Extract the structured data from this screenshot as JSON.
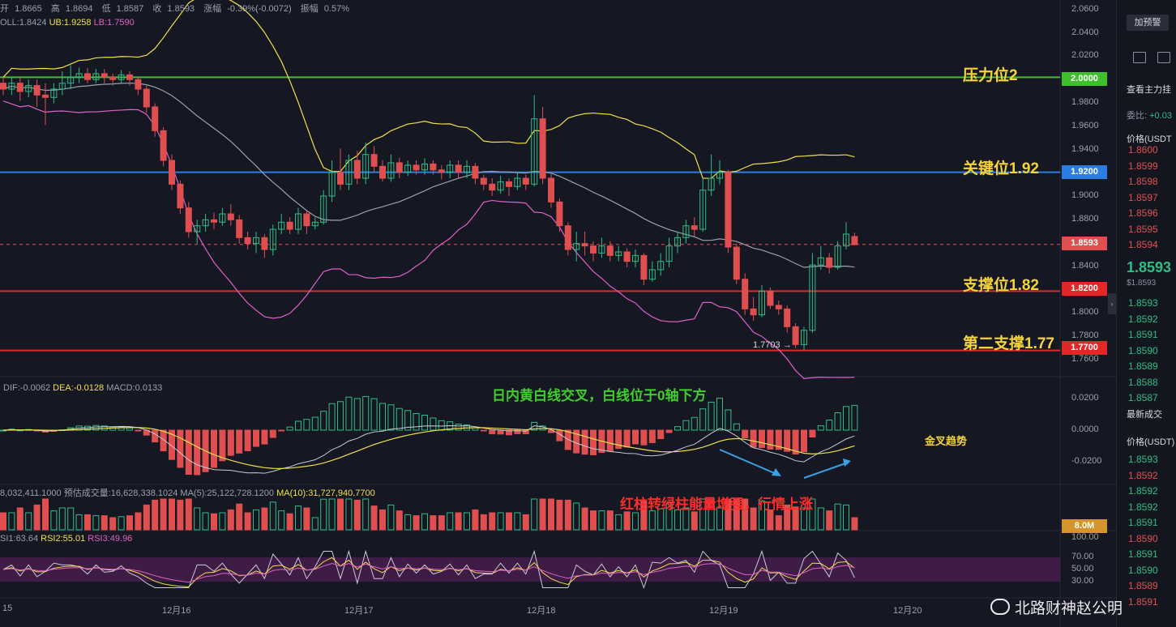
{
  "header": {
    "ohlc": [
      {
        "label": "开",
        "value": "1.8665"
      },
      {
        "label": "高",
        "value": "1.8694"
      },
      {
        "label": "低",
        "value": "1.8587"
      },
      {
        "label": "收",
        "value": "1.8593"
      },
      {
        "label": "涨幅",
        "value": "-0.39%(-0.0072)"
      },
      {
        "label": "振幅",
        "value": "0.57%"
      }
    ],
    "boll": {
      "mid": "OLL:1.8424",
      "ub": "UB:1.9258",
      "lb": "LB:1.7590"
    },
    "macd": {
      "dif": "DIF:-0.0062",
      "dea": "DEA:-0.0128",
      "macd": "MACD:0.0133"
    },
    "vol": {
      "vol": "8,032,411.1000",
      "est": "预估成交量:16,628,338.1024",
      "ma5": "MA(5):25,122,728.1200",
      "ma10": "MA(10):31,727,940.7700"
    },
    "rsi": {
      "rsi1": "SI1:63.64",
      "rsi2": "RSI2:55.01",
      "rsi3": "RSI3:49.96"
    }
  },
  "levels": [
    {
      "label": "压力位2",
      "price": "2.0000",
      "value": 2.0,
      "color": "#3fbf2c"
    },
    {
      "label": "关键位1.92",
      "price": "1.9200",
      "value": 1.92,
      "color": "#2a7de1"
    },
    {
      "label": "支撑位1.82",
      "price": "1.8200",
      "value": 1.82,
      "color": "#e02828"
    },
    {
      "label": "第二支撑1.77",
      "price": "1.7700",
      "value": 1.77,
      "color": "#e02828"
    }
  ],
  "current_price": {
    "price": "1.8593",
    "value": 1.8593
  },
  "low_marker": "1.7703",
  "annotations": {
    "macd_note": "日内黄白线交叉，白线位于0轴下方",
    "golden_cross": "金叉趋势",
    "volume_note": "红柱转绿柱能量增强，行情上涨"
  },
  "volume_tag": "8.0M",
  "watermark": "北路财神赵公明",
  "panel": {
    "alert_button": "加预警",
    "main_force": "查看主力挂",
    "ratio_label": "委比:",
    "ratio_value": "+0.03",
    "price_header": "价格(USDT",
    "ask_prices": [
      "1.8600",
      "1.8599",
      "1.8598",
      "1.8597",
      "1.8596",
      "1.8595",
      "1.8594"
    ],
    "last_price": "1.8593",
    "last_usd": "$1.8593",
    "bid_prices": [
      "1.8593",
      "1.8592",
      "1.8591",
      "1.8590",
      "1.8589",
      "1.8588",
      "1.8587"
    ],
    "trades_title": "最新成交",
    "trades_header": "价格(USDT)",
    "trades": [
      {
        "p": "1.8593",
        "c": "#2ebd85"
      },
      {
        "p": "1.8592",
        "c": "#e04f4f"
      },
      {
        "p": "1.8592",
        "c": "#2ebd85"
      },
      {
        "p": "1.8592",
        "c": "#2ebd85"
      },
      {
        "p": "1.8591",
        "c": "#2ebd85"
      },
      {
        "p": "1.8590",
        "c": "#e04f4f"
      },
      {
        "p": "1.8591",
        "c": "#2ebd85"
      },
      {
        "p": "1.8590",
        "c": "#2ebd85"
      },
      {
        "p": "1.8589",
        "c": "#e04f4f"
      },
      {
        "p": "1.8591",
        "c": "#e04f4f"
      }
    ]
  },
  "chart_data": {
    "type": "candlestick",
    "y_ticks": [
      "2.0600",
      "2.0400",
      "2.0200",
      "1.9800",
      "1.9600",
      "1.9400",
      "1.9000",
      "1.8800",
      "1.8400",
      "1.8000",
      "1.7800",
      "1.7600"
    ],
    "ylim": [
      1.75,
      2.065
    ],
    "x_ticks": [
      "15",
      "12月16",
      "12月17",
      "12月18",
      "12月19",
      "12月20"
    ],
    "macd_ticks": [
      "0.0200",
      "0.0000",
      "-0.0200"
    ],
    "rsi_ticks": [
      "100.00",
      "70.00",
      "50.00",
      "30.00"
    ],
    "candles": [
      [
        1.995,
        1.99,
        2.0,
        1.985
      ],
      [
        1.99,
        1.995,
        2.0,
        1.985
      ],
      [
        1.995,
        1.988,
        2.0,
        1.98
      ],
      [
        1.988,
        1.993,
        1.998,
        1.983
      ],
      [
        1.993,
        1.985,
        1.998,
        1.975
      ],
      [
        1.985,
        1.983,
        1.995,
        1.96
      ],
      [
        1.983,
        1.99,
        1.995,
        1.978
      ],
      [
        1.99,
        1.995,
        2.005,
        1.985
      ],
      [
        1.995,
        2.0,
        2.01,
        1.99
      ],
      [
        2.0,
        2.003,
        2.008,
        1.995
      ],
      [
        2.003,
        1.998,
        2.008,
        1.995
      ],
      [
        1.998,
        2.003,
        2.007,
        1.995
      ],
      [
        2.003,
        2.0,
        2.007,
        1.995
      ],
      [
        2.0,
        1.998,
        2.003,
        1.993
      ],
      [
        1.998,
        2.002,
        2.006,
        1.995
      ],
      [
        2.002,
        1.998,
        2.005,
        1.993
      ],
      [
        1.998,
        1.99,
        2.0,
        1.985
      ],
      [
        1.99,
        1.975,
        1.993,
        1.97
      ],
      [
        1.975,
        1.955,
        1.978,
        1.95
      ],
      [
        1.955,
        1.93,
        1.958,
        1.925
      ],
      [
        1.93,
        1.91,
        1.935,
        1.905
      ],
      [
        1.91,
        1.89,
        1.913,
        1.885
      ],
      [
        1.89,
        1.87,
        1.895,
        1.865
      ],
      [
        1.87,
        1.875,
        1.88,
        1.86
      ],
      [
        1.875,
        1.88,
        1.885,
        1.87
      ],
      [
        1.88,
        1.878,
        1.886,
        1.872
      ],
      [
        1.878,
        1.885,
        1.89,
        1.875
      ],
      [
        1.885,
        1.88,
        1.893,
        1.875
      ],
      [
        1.88,
        1.865,
        1.884,
        1.86
      ],
      [
        1.865,
        1.86,
        1.87,
        1.855
      ],
      [
        1.86,
        1.865,
        1.87,
        1.852
      ],
      [
        1.865,
        1.855,
        1.868,
        1.848
      ],
      [
        1.855,
        1.872,
        1.876,
        1.85
      ],
      [
        1.872,
        1.878,
        1.885,
        1.868
      ],
      [
        1.878,
        1.872,
        1.882,
        1.868
      ],
      [
        1.872,
        1.885,
        1.89,
        1.868
      ],
      [
        1.885,
        1.875,
        1.888,
        1.868
      ],
      [
        1.875,
        1.878,
        1.882,
        1.872
      ],
      [
        1.878,
        1.9,
        1.905,
        1.876
      ],
      [
        1.9,
        1.92,
        1.93,
        1.895
      ],
      [
        1.92,
        1.91,
        1.94,
        1.905
      ],
      [
        1.91,
        1.93,
        1.935,
        1.905
      ],
      [
        1.93,
        1.915,
        1.938,
        1.91
      ],
      [
        1.915,
        1.935,
        1.945,
        1.91
      ],
      [
        1.935,
        1.925,
        1.942,
        1.92
      ],
      [
        1.925,
        1.915,
        1.93,
        1.912
      ],
      [
        1.915,
        1.928,
        1.935,
        1.912
      ],
      [
        1.928,
        1.92,
        1.932,
        1.915
      ],
      [
        1.92,
        1.926,
        1.93,
        1.917
      ],
      [
        1.926,
        1.922,
        1.93,
        1.918
      ],
      [
        1.922,
        1.927,
        1.932,
        1.918
      ],
      [
        1.927,
        1.922,
        1.93,
        1.918
      ],
      [
        1.922,
        1.92,
        1.926,
        1.914
      ],
      [
        1.92,
        1.926,
        1.93,
        1.915
      ],
      [
        1.926,
        1.92,
        1.93,
        1.915
      ],
      [
        1.92,
        1.925,
        1.93,
        1.915
      ],
      [
        1.925,
        1.915,
        1.928,
        1.91
      ],
      [
        1.915,
        1.91,
        1.918,
        1.905
      ],
      [
        1.91,
        1.905,
        1.915,
        1.9
      ],
      [
        1.905,
        1.912,
        1.917,
        1.902
      ],
      [
        1.912,
        1.908,
        1.915,
        1.9
      ],
      [
        1.908,
        1.915,
        1.92,
        1.905
      ],
      [
        1.915,
        1.91,
        1.918,
        1.905
      ],
      [
        1.91,
        1.965,
        1.985,
        1.908
      ],
      [
        1.965,
        1.915,
        1.975,
        1.91
      ],
      [
        1.915,
        1.895,
        1.92,
        1.89
      ],
      [
        1.895,
        1.875,
        1.898,
        1.87
      ],
      [
        1.875,
        1.855,
        1.878,
        1.85
      ],
      [
        1.855,
        1.86,
        1.87,
        1.845
      ],
      [
        1.86,
        1.858,
        1.87,
        1.85
      ],
      [
        1.858,
        1.852,
        1.862,
        1.845
      ],
      [
        1.852,
        1.858,
        1.865,
        1.848
      ],
      [
        1.858,
        1.85,
        1.862,
        1.845
      ],
      [
        1.85,
        1.853,
        1.858,
        1.845
      ],
      [
        1.853,
        1.845,
        1.856,
        1.84
      ],
      [
        1.845,
        1.85,
        1.855,
        1.84
      ],
      [
        1.85,
        1.83,
        1.852,
        1.825
      ],
      [
        1.83,
        1.838,
        1.845,
        1.828
      ],
      [
        1.838,
        1.845,
        1.852,
        1.833
      ],
      [
        1.845,
        1.858,
        1.865,
        1.84
      ],
      [
        1.858,
        1.865,
        1.87,
        1.852
      ],
      [
        1.865,
        1.875,
        1.88,
        1.86
      ],
      [
        1.875,
        1.872,
        1.882,
        1.866
      ],
      [
        1.872,
        1.905,
        1.915,
        1.87
      ],
      [
        1.905,
        1.915,
        1.935,
        1.9
      ],
      [
        1.915,
        1.92,
        1.93,
        1.91
      ],
      [
        1.92,
        1.857,
        1.922,
        1.852
      ],
      [
        1.857,
        1.83,
        1.86,
        1.826
      ],
      [
        1.83,
        1.805,
        1.835,
        1.8
      ],
      [
        1.805,
        1.8,
        1.815,
        1.795
      ],
      [
        1.8,
        1.82,
        1.825,
        1.798
      ],
      [
        1.82,
        1.808,
        1.823,
        1.805
      ],
      [
        1.808,
        1.805,
        1.812,
        1.8
      ],
      [
        1.805,
        1.79,
        1.808,
        1.785
      ],
      [
        1.79,
        1.775,
        1.793,
        1.772
      ],
      [
        1.775,
        1.787,
        1.79,
        1.77
      ],
      [
        1.787,
        1.842,
        1.852,
        1.785
      ],
      [
        1.842,
        1.848,
        1.858,
        1.838
      ],
      [
        1.848,
        1.84,
        1.852,
        1.835
      ],
      [
        1.84,
        1.858,
        1.862,
        1.838
      ],
      [
        1.858,
        1.868,
        1.878,
        1.855
      ],
      [
        1.866,
        1.859,
        1.869,
        1.859
      ]
    ]
  }
}
